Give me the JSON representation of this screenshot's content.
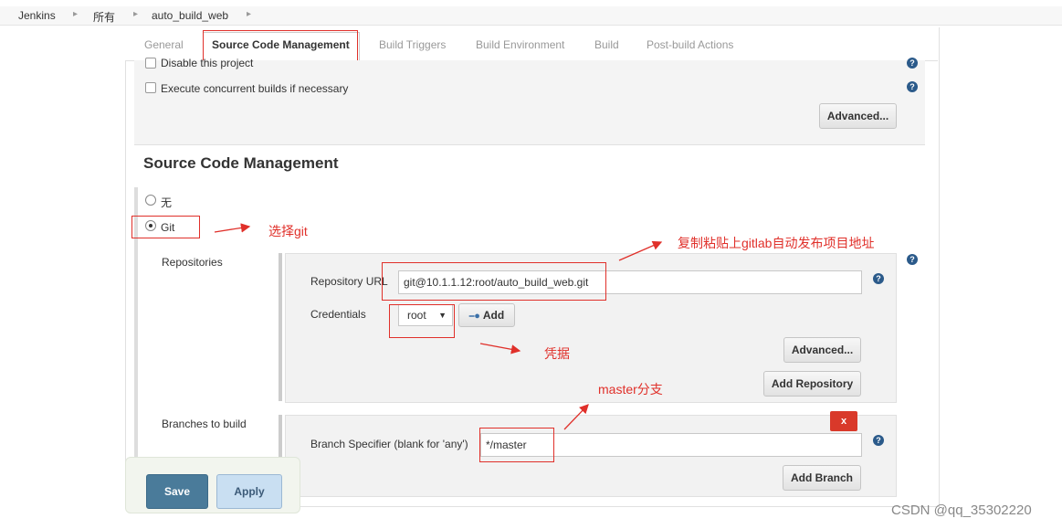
{
  "breadcrumb": {
    "items": [
      "Jenkins",
      "所有",
      "auto_build_web"
    ]
  },
  "tabs": [
    "General",
    "Source Code Management",
    "Build Triggers",
    "Build Environment",
    "Build",
    "Post-build Actions"
  ],
  "general": {
    "disable_project": "Disable this project",
    "concurrent_builds": "Execute concurrent builds if necessary",
    "advanced_button": "Advanced..."
  },
  "scm": {
    "title": "Source Code Management",
    "option_none": "无",
    "option_git": "Git",
    "repositories_label": "Repositories",
    "repo_url_label": "Repository URL",
    "repo_url_value": "git@10.1.1.12:root/auto_build_web.git",
    "credentials_label": "Credentials",
    "credentials_value": "root",
    "add_button": "Add",
    "repo_advanced_button": "Advanced...",
    "add_repository_button": "Add Repository",
    "branches_label": "Branches to build",
    "branch_spec_label": "Branch Specifier (blank for 'any')",
    "branch_spec_value": "*/master",
    "delete_branch_button": "x",
    "add_branch_button": "Add Branch"
  },
  "actions": {
    "save": "Save",
    "apply": "Apply"
  },
  "annotations": {
    "select_git": "选择git",
    "copy_paste_url": "复制粘贴上gitlab自动发布项目地址",
    "credentials": "凭据",
    "master_branch": "master分支"
  },
  "icons": {
    "help": "help-icon",
    "key": "key-icon",
    "breadcrumb_separator": "chevron-right-icon"
  },
  "colors": {
    "annotation_red": "#e0302a",
    "save_button": "#4a7b9a",
    "apply_button": "#c9dff2",
    "delete_button": "#d9392a",
    "help_icon": "#2b5a8a"
  },
  "watermark": "CSDN @qq_35302220"
}
